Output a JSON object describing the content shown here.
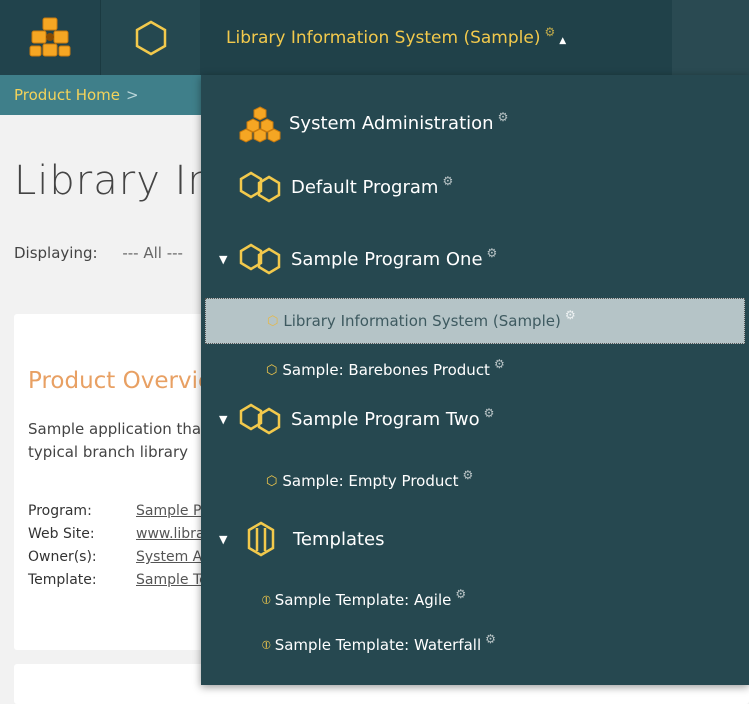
{
  "nav": {
    "product_label": "Library Information System (Sample)"
  },
  "breadcrumb": {
    "home": "Product Home",
    "separator": ">"
  },
  "page": {
    "title": "Library Information System (Sample)",
    "displaying_label": "Displaying:",
    "displaying_value": "--- All ---"
  },
  "overview": {
    "title": "Product Overview",
    "description": "Sample application that allows users to manage books, authors and lending records for a typical branch library",
    "properties": [
      {
        "label": "Program:",
        "value": "Sample Program One"
      },
      {
        "label": "Web Site:",
        "value": "www.libraryinformationsystem.org"
      },
      {
        "label": "Owner(s):",
        "value": "System Administrator"
      },
      {
        "label": "Template:",
        "value": "Sample Template: Agile"
      }
    ]
  },
  "menu": {
    "system_admin": "System Administration",
    "default_program": "Default Program",
    "program_one": "Sample Program One",
    "program_one_items": [
      "Library Information System (Sample)",
      "Sample: Barebones Product"
    ],
    "program_two": "Sample Program Two",
    "program_two_items": [
      "Sample: Empty Product"
    ],
    "templates": "Templates",
    "template_items": [
      "Sample Template: Agile",
      "Sample Template: Waterfall"
    ]
  },
  "colors": {
    "accent": "#f2c94c",
    "nav_bg": "#204149",
    "breadcrumb_bg": "#3f7f8a",
    "menu_bg": "#264850",
    "selected_bg": "#b5c4c7"
  }
}
